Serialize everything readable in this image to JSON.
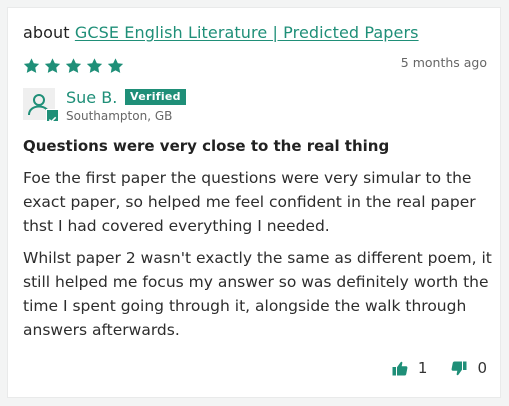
{
  "about": {
    "prefix": "about",
    "product_link": "GCSE English Literature | Predicted Papers"
  },
  "rating": {
    "stars": 5,
    "max": 5,
    "color": "#1f8f78"
  },
  "date": "5 months ago",
  "reviewer": {
    "name": "Sue B.",
    "verified_label": "Verified",
    "location": "Southampton, GB",
    "avatar_icon": "user-icon"
  },
  "review": {
    "title": "Questions were very close to the real thing",
    "paragraphs": [
      "Foe the first paper the questions were very simular to the exact paper, so helped me feel confident in the real paper thst I had covered everything I needed.",
      "Whilst paper 2 wasn't exactly the same as different poem, it still helped me focus my answer so was definitely worth the time I spent going through it, alongside the walk through answers afterwards."
    ]
  },
  "votes": {
    "up_icon": "thumbs-up-icon",
    "up_count": "1",
    "down_icon": "thumbs-down-icon",
    "down_count": "0"
  },
  "colors": {
    "accent": "#1f8f78",
    "text": "#222222",
    "muted": "#666666"
  }
}
